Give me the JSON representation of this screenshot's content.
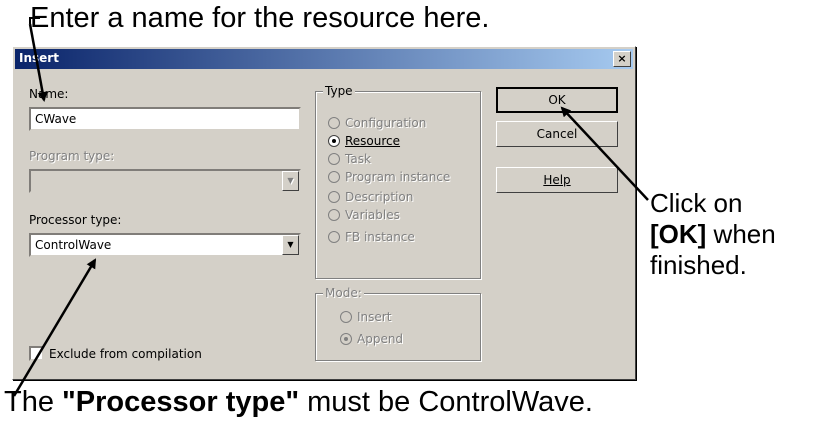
{
  "annotations": {
    "top": "Enter a name for the resource here.",
    "right_line1": "Click on",
    "right_line2_bold": "[OK]",
    "right_line2_rest": " when",
    "right_line3": "finished.",
    "bottom_pre": "The ",
    "bottom_bold": "\"Processor type\"",
    "bottom_post": " must be ControlWave."
  },
  "dialog": {
    "title": "Insert",
    "close_glyph": "×",
    "name_label": "Name:",
    "name_value": "CWave",
    "program_type_label": "Program type:",
    "program_type_value": "",
    "processor_type_label": "Processor type:",
    "processor_type_value": "ControlWave",
    "combo_arrow": "▼",
    "exclude_label": "Exclude from compilation",
    "type_group": {
      "title": "Type",
      "options": [
        "Configuration",
        "Resource",
        "Task",
        "Program instance",
        "Description",
        "Variables",
        "FB instance"
      ],
      "selected": "Resource"
    },
    "mode_group": {
      "title": "Mode:",
      "options": [
        "Insert",
        "Append"
      ],
      "selected": "Append"
    },
    "buttons": {
      "ok": "OK",
      "cancel": "Cancel",
      "help": "Help"
    }
  },
  "colors": {
    "titlebar_start": "#0a246a",
    "titlebar_end": "#a6caf0",
    "dialog_bg": "#d4d0c8"
  }
}
